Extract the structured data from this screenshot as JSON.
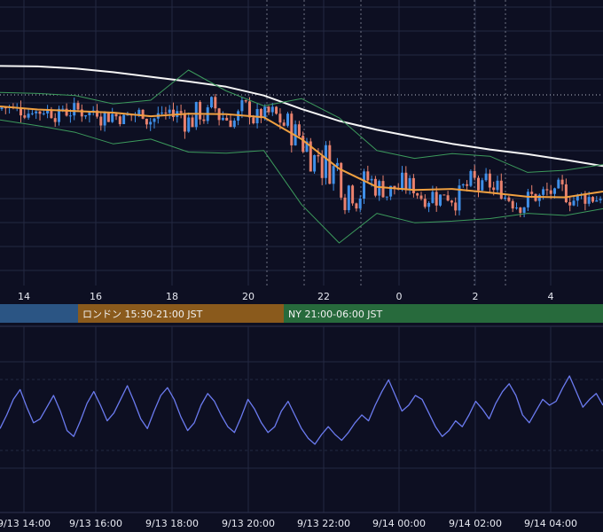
{
  "colors": {
    "background": "#0d0f22",
    "grid": "#232842",
    "candle_up": "#3f8fe8",
    "candle_down": "#e9826e",
    "ma_long": "#f5f5f5",
    "ma_short": "#f0a040",
    "bollinger": "#3c9a5c",
    "oscillator": "#6b7bf0",
    "session_tokyo": "#2b5584",
    "session_london": "#8a5a1c",
    "session_ny": "#276a3c"
  },
  "main_chart": {
    "x_ticks": [
      "14",
      "16",
      "18",
      "20",
      "22",
      "0",
      "2",
      "4"
    ]
  },
  "sessions": [
    {
      "label": "",
      "color_key": "session_tokyo"
    },
    {
      "label": "ロンドン 15:30-21:00 JST",
      "color_key": "session_london"
    },
    {
      "label": "NY 21:00-06:00 JST",
      "color_key": "session_ny"
    }
  ],
  "oscillator_chart": {
    "x_ticks": [
      "9/13 14:00",
      "9/13 16:00",
      "9/13 18:00",
      "9/13 20:00",
      "9/13 22:00",
      "9/14 00:00",
      "9/14 02:00",
      "9/14 04:00"
    ]
  },
  "chart_data": [
    {
      "type": "candlestick",
      "x_range": [
        "9/13 13:40",
        "9/14 05:45"
      ],
      "x_ticks": [
        "14",
        "16",
        "18",
        "20",
        "22",
        "0",
        "2",
        "4"
      ],
      "grid": true,
      "notes": "Price axis values not shown; values are relative price levels (higher = up).",
      "series": [
        {
          "name": "",
          "kind": "moving-average-long",
          "x": [
            0,
            1,
            2,
            3,
            4,
            5,
            6,
            7,
            8,
            9,
            10,
            11,
            12,
            13,
            14,
            15,
            16
          ],
          "y": [
            97.3,
            97.2,
            96.8,
            96.1,
            95.2,
            94.3,
            93.3,
            91.6,
            89.0,
            86.7,
            85.0,
            83.6,
            82.3,
            81.2,
            80.3,
            79.2,
            78.0
          ]
        },
        {
          "name": "",
          "kind": "moving-average-short",
          "x": [
            0,
            1,
            2,
            3,
            4,
            5,
            6,
            7,
            8,
            9,
            10,
            11,
            12,
            13,
            14,
            15,
            16
          ],
          "y": [
            89.5,
            88.9,
            88.6,
            88.3,
            87.6,
            88.1,
            88.0,
            87.4,
            83.2,
            77.5,
            74.0,
            73.4,
            73.6,
            72.9,
            72.1,
            72.0,
            73.1
          ]
        },
        {
          "name": "",
          "kind": "bollinger-upper",
          "x": [
            0,
            1,
            2,
            3,
            4,
            5,
            6,
            7,
            8,
            9,
            10,
            11,
            12,
            13,
            14,
            15,
            16
          ],
          "y": [
            92.2,
            92.0,
            91.6,
            90.0,
            90.7,
            96.5,
            92.5,
            89.6,
            91.0,
            87.3,
            81.0,
            79.5,
            80.4,
            79.9,
            76.8,
            77.2,
            78.3
          ]
        },
        {
          "name": "",
          "kind": "bollinger-lower",
          "x": [
            0,
            1,
            2,
            3,
            4,
            5,
            6,
            7,
            8,
            9,
            10,
            11,
            12,
            13,
            14,
            15,
            16
          ],
          "y": [
            86.9,
            85.8,
            84.5,
            82.3,
            83.2,
            80.7,
            80.5,
            81.0,
            70.6,
            63.2,
            68.9,
            67.1,
            67.4,
            67.9,
            68.9,
            68.5,
            69.8
          ]
        }
      ]
    },
    {
      "type": "line",
      "x_range": [
        "9/13 13:40",
        "9/14 05:45"
      ],
      "x_ticks": [
        "9/13 14:00",
        "9/13 16:00",
        "9/13 18:00",
        "9/13 20:00",
        "9/13 22:00",
        "9/14 00:00",
        "9/14 02:00",
        "9/14 04:00"
      ],
      "grid": true,
      "series": [
        {
          "name": "",
          "y": [
            43,
            50,
            58,
            63,
            54,
            46,
            48,
            54,
            60,
            52,
            42,
            39,
            47,
            56,
            62,
            55,
            47,
            51,
            58,
            65,
            57,
            48,
            43,
            52,
            60,
            64,
            58,
            49,
            42,
            46,
            55,
            61,
            57,
            50,
            44,
            41,
            49,
            58,
            53,
            46,
            41,
            44,
            52,
            57,
            50,
            43,
            38,
            35,
            40,
            44,
            40,
            37,
            41,
            46,
            50,
            47,
            55,
            62,
            68,
            60,
            52,
            55,
            60,
            58,
            51,
            44,
            39,
            42,
            47,
            44,
            50,
            57,
            53,
            48,
            56,
            62,
            66,
            60,
            50,
            46,
            52,
            58,
            55,
            57,
            64,
            70,
            62,
            54,
            58,
            61,
            55
          ]
        }
      ]
    }
  ]
}
